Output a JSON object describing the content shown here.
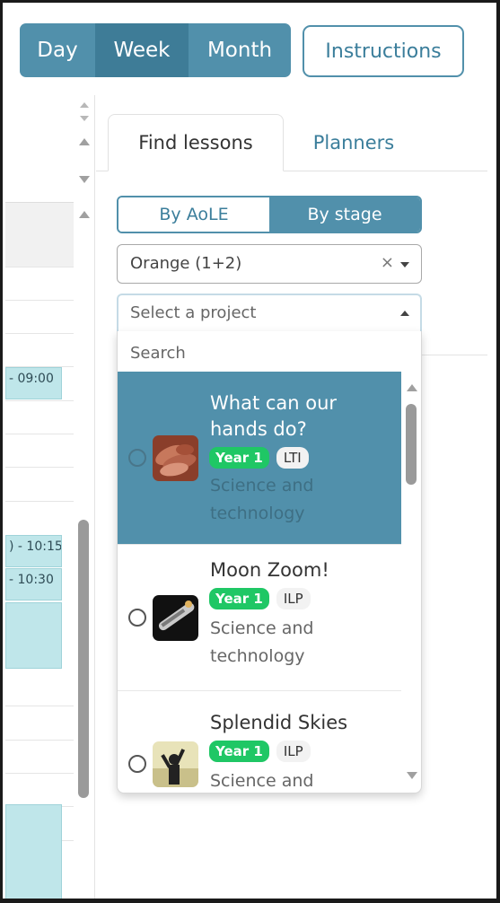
{
  "view_switch": {
    "day": "Day",
    "week": "Week",
    "month": "Month",
    "selected": "Week"
  },
  "instructions_label": "Instructions",
  "calendar": {
    "events": [
      "- 09:00",
      ") - 10:15",
      "- 10:30",
      "",
      ""
    ],
    "colors": {
      "event_bg": "#bfe6ea"
    }
  },
  "tabs": {
    "find_lessons": "Find lessons",
    "planners": "Planners"
  },
  "filter_toggle": {
    "by_aole": "By AoLE",
    "by_stage": "By stage",
    "selected": "By stage"
  },
  "stage_select": {
    "value": "Orange (1+2)",
    "clear": "×"
  },
  "project_select": {
    "placeholder": "Select a project",
    "search_placeholder": "Search",
    "items": [
      {
        "title": "What can our hands do?",
        "year": "Year 1",
        "type": "LTI",
        "subject": "Science and technology",
        "thumb": "hands-thumbnail",
        "selected": true
      },
      {
        "title": "Moon Zoom!",
        "year": "Year 1",
        "type": "ILP",
        "subject": "Science and technology",
        "thumb": "rocket-thumbnail",
        "selected": false
      },
      {
        "title": "Splendid Skies",
        "year": "Year 1",
        "type": "ILP",
        "subject": "Science and",
        "thumb": "sky-person-thumbnail",
        "selected": false
      }
    ]
  },
  "colors": {
    "accent": "#5190ab",
    "accent_dark": "#3e7c97",
    "year_badge": "#1fc765"
  }
}
